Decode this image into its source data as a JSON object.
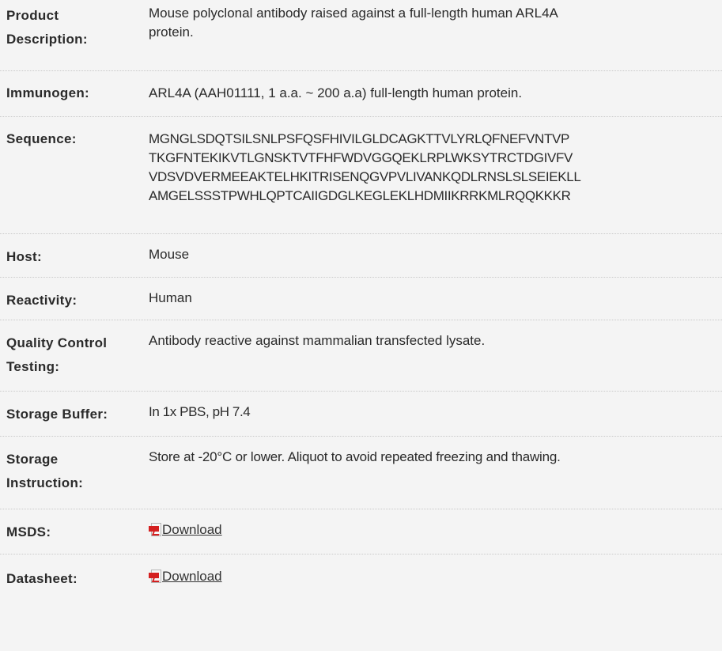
{
  "rows": {
    "product_description": {
      "label_line1": "Product",
      "label_line2": "Description:",
      "value_line1": "Mouse polyclonal antibody raised against a full-length human ARL4A",
      "value_line2": "protein."
    },
    "immunogen": {
      "label": "Immunogen:",
      "value": "ARL4A (AAH01111, 1 a.a. ~ 200 a.a) full-length human protein."
    },
    "sequence": {
      "label": "Sequence:",
      "lines": [
        "MGNGLSDQTSILSNLPSFQSFHIVILGLDCAGKTTVLYRLQFNEFVNTVP",
        "TKGFNTEKIKVTLGNSKTVTFHFWDVGGQEKLRPLWKSYTRCTDGIVFV",
        "VDSVDVERMEEAKTELHKITRISENQGVPVLIVANKQDLRNSLSLSEIEKLL",
        "AMGELSSSTPWHLQPTCAIIGDGLKEGLEKLHDMIIKRRKMLRQQKKKR"
      ]
    },
    "host": {
      "label": "Host:",
      "value": "Mouse"
    },
    "reactivity": {
      "label": "Reactivity:",
      "value": "Human"
    },
    "quality_control": {
      "label_line1": "Quality Control",
      "label_line2": "Testing:",
      "value": "Antibody reactive against mammalian transfected lysate."
    },
    "storage_buffer": {
      "label": "Storage Buffer:",
      "value": "In 1x PBS, pH 7.4"
    },
    "storage_instruction": {
      "label_line1": "Storage",
      "label_line2": "Instruction:",
      "value": "Store at -20°C or lower. Aliquot to avoid repeated freezing and thawing."
    },
    "msds": {
      "label": "MSDS:",
      "link_text": "Download",
      "icon": "pdf-icon"
    },
    "datasheet": {
      "label": "Datasheet:",
      "link_text": "Download",
      "icon": "pdf-icon"
    }
  },
  "colors": {
    "background": "#f4f4f4",
    "text": "#2a2a2a",
    "divider": "#c9c9c9",
    "pdf_red": "#d42020"
  }
}
